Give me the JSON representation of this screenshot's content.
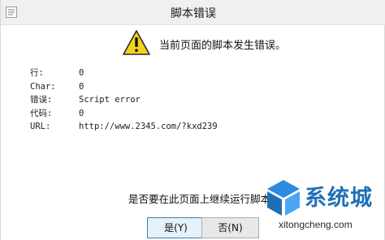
{
  "dialog": {
    "title": "脚本错误",
    "message": "当前页面的脚本发生错误。",
    "question": "是否要在此页面上继续运行脚本?"
  },
  "details": [
    {
      "label": "行:",
      "value": "0"
    },
    {
      "label": "Char:",
      "value": "0"
    },
    {
      "label": "错误:",
      "value": "Script error"
    },
    {
      "label": "代码:",
      "value": "0"
    },
    {
      "label": "URL:",
      "value": "http://www.2345.com/?kxd239"
    }
  ],
  "buttons": {
    "yes_label": "是(Y)",
    "no_label": "否(N)"
  },
  "watermark": {
    "brand": "系统城",
    "site": "xitongcheng.com"
  },
  "colors": {
    "warning_yellow": "#f5d31b",
    "watermark_blue": "#1f6fb8"
  }
}
